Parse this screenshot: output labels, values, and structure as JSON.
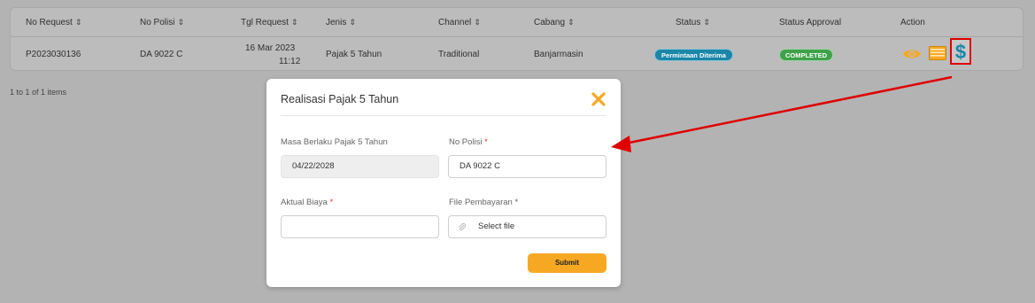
{
  "table": {
    "headers": {
      "no_request": "No Request",
      "no_polisi": "No Polisi",
      "tgl_request": "Tgl Request",
      "jenis": "Jenis",
      "channel": "Channel",
      "cabang": "Cabang",
      "status": "Status",
      "status_approval": "Status Approval",
      "action": "Action"
    },
    "sort_glyph": "⇕",
    "rows": [
      {
        "no_request": "P2023030136",
        "no_polisi": "DA 9022 C",
        "tgl_date": "16 Mar 2023",
        "tgl_time": "11:12",
        "jenis": "Pajak 5 Tahun",
        "channel": "Traditional",
        "cabang": "Banjarmasin",
        "status": "Permintaan Diterima",
        "status_approval": "COMPLETED",
        "actions": [
          "eye-icon",
          "list-icon",
          "dollar-icon"
        ]
      }
    ]
  },
  "pagination": {
    "text": "1 to 1 of 1 items"
  },
  "modal": {
    "title": "Realisasi Pajak 5 Tahun",
    "fields": {
      "masa_label": "Masa Berlaku Pajak 5 Tahun",
      "masa_value": "04/22/2028",
      "polisi_label": "No Polisi",
      "polisi_value": "DA 9022 C",
      "biaya_label": "Aktual Biaya",
      "biaya_value": "",
      "file_label": "File Pembayaran",
      "file_placeholder": "Select file"
    },
    "required_mark": "*",
    "submit_label": "Submit"
  },
  "colors": {
    "status_badge": "#1a86a8",
    "approval_badge": "#3fa24a",
    "accent": "#f7a823",
    "annotation": "#e00000",
    "dollar": "#1a86a8"
  }
}
